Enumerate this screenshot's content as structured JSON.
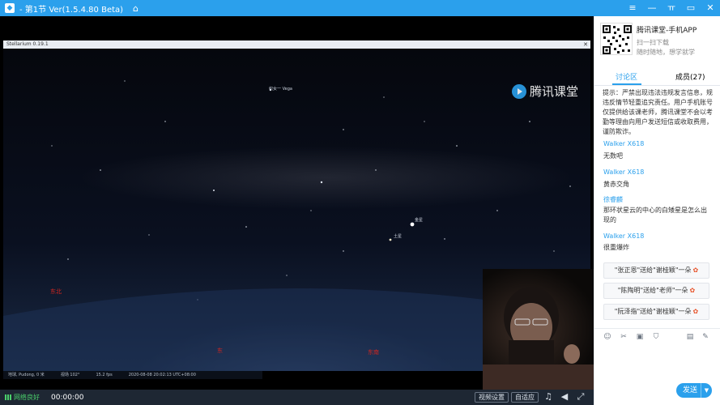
{
  "window": {
    "title": "- 第1节 Ver(1.5.4.80 Beta)",
    "controls": [
      "≡",
      "—",
      "ㅠ",
      "▭",
      "✕"
    ]
  },
  "stage": {
    "stellarium_title": "Stellarium 0.19.1",
    "watermark": "腾讯课堂",
    "star_labels": {
      "vega": "织女一 Vega",
      "venus": "金星",
      "saturn": "土星"
    },
    "directions": {
      "northeast": "东北",
      "east": "东",
      "southeast": "东南"
    },
    "status": [
      "地球, Pudong, 0 米",
      "视场 102°",
      "15.2 fps",
      "2020-08-08 20:02:13 UTC+08:00"
    ]
  },
  "bottombar": {
    "network": "网络良好",
    "timer": "00:00:00",
    "view_settings": "视频设置",
    "fit": "自适应"
  },
  "panel": {
    "app_name": "腾讯课堂-手机APP",
    "app_sub1": "扫一扫下载",
    "app_sub2": "随时随地，想学就学",
    "tab_discussion": "讨论区",
    "tab_members": "成员(27)",
    "notice": "提示：严禁出现违法违规发言信息，规违反情节轻重追究责任。用户手机账号仅提供给该课老师，腾讯课堂不会以考勤等理由向用户发送短信或收取费用，谨防欺诈。",
    "messages": [
      {
        "name": "Walker X618",
        "text": "无数吧"
      },
      {
        "name": "Walker X618",
        "text": "黄赤交角"
      },
      {
        "name": "徐睿麟",
        "text": "那环状星云的中心的白矮星是怎么出现的"
      },
      {
        "name": "Walker X618",
        "text": "很重爆炸"
      }
    ],
    "gifts": [
      "\"张正恩\"送给\"谢桂颖\"一朵",
      "\"陈陶明\"送给\"老师\"一朵",
      "\"阮泽指\"送给\"谢桂颖\"一朵"
    ],
    "send": "发送"
  }
}
